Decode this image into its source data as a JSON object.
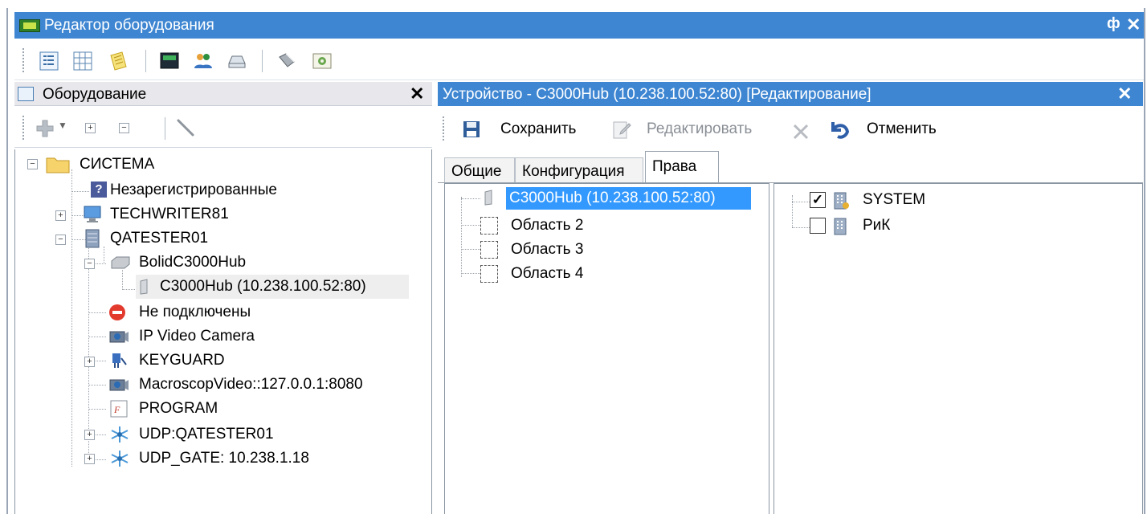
{
  "window": {
    "title": "Редактор оборудования",
    "pin_glyph": "ф",
    "close_glyph": "✕"
  },
  "left_panel": {
    "title": "Оборудование",
    "close_glyph": "✕",
    "tree": {
      "root": "СИСТЕМА",
      "unregistered": "Незарегистрированные",
      "techwriter": "TECHWRITER81",
      "qatester": "QATESTER01",
      "bolid": "BolidC3000Hub",
      "c3000hub": "C3000Hub (10.238.100.52:80)",
      "not_connected": "Не подключены",
      "ip_camera": "IP Video Camera",
      "keyguard": "KEYGUARD",
      "macroscop": "MacroscopVideo::127.0.0.1:8080",
      "program": "PROGRAM",
      "udp_qatester": "UDP:QATESTER01",
      "udp_gate": "UDP_GATE: 10.238.1.18"
    }
  },
  "right_panel": {
    "title": "Устройство - C3000Hub (10.238.100.52:80) [Редактирование]",
    "close_glyph": "✕",
    "toolbar": {
      "save": "Сохранить",
      "edit": "Редактировать",
      "cancel": "Отменить"
    },
    "tabs": [
      "Общие",
      "Конфигурация",
      "Права"
    ],
    "active_tab": "Права",
    "areas": {
      "device": "C3000Hub (10.238.100.52:80)",
      "area2": "Область 2",
      "area3": "Область 3",
      "area4": "Область 4"
    },
    "rights": {
      "system": "SYSTEM",
      "system_checked": true,
      "rik": "РиК",
      "rik_checked": false
    }
  },
  "colors": {
    "title_bar": "#3e86d2",
    "selection": "#3399ff"
  },
  "icons": {
    "app": "equipment-editor-icon",
    "save": "floppy-icon",
    "edit": "edit-icon",
    "delete": "cross-icon",
    "cancel": "undo-icon"
  }
}
